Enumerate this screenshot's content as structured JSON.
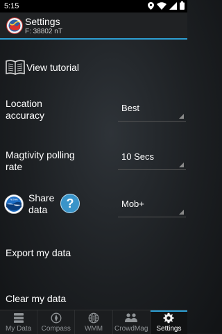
{
  "status": {
    "time": "5:15"
  },
  "app": {
    "title": "Settings",
    "subtitle": "F: 38802 nT"
  },
  "settings": {
    "tutorial_label": "View tutorial",
    "location_label_line1": "Location",
    "location_label_line2": "accuracy",
    "location_value": "Best",
    "polling_label_line1": "Magtivity polling",
    "polling_label_line2": "rate",
    "polling_value": "10 Secs",
    "share_label_line1": "Share",
    "share_label_line2": "data",
    "share_value": "Mob+",
    "noaa_logo_text": "NOAA",
    "help_symbol": "?",
    "export_label": "Export my data",
    "clear_label": "Clear my data"
  },
  "nav": {
    "items": [
      {
        "label": "My Data",
        "icon": "list-icon"
      },
      {
        "label": "Compass",
        "icon": "compass-icon"
      },
      {
        "label": "WMM",
        "icon": "globe-icon"
      },
      {
        "label": "CrowdMag",
        "icon": "people-icon"
      },
      {
        "label": "Settings",
        "icon": "gear-icon"
      }
    ],
    "active": "Settings"
  },
  "colors": {
    "accent": "#2d9fd3",
    "help_badge": "#3a94c9"
  }
}
